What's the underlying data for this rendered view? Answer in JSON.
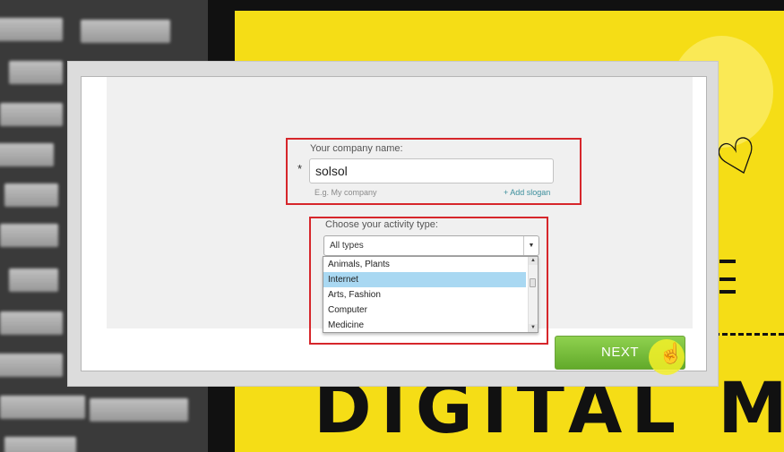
{
  "form": {
    "company_label": "Your company name:",
    "required_mark": "*",
    "company_value": "solsol",
    "company_hint": "E.g. My company",
    "add_slogan": "+ Add slogan",
    "activity_label": "Choose your activity type:",
    "activity_selected": "All types",
    "activity_options": [
      "Animals, Plants",
      "Internet",
      "Arts, Fashion",
      "Computer",
      "Medicine"
    ],
    "highlighted_option": "Internet"
  },
  "buttons": {
    "next_label": "NEXT"
  },
  "background": {
    "poster_text": "DIGITAL MAR"
  },
  "colors": {
    "highlight_border": "#d6262b",
    "next_button": "#7cc242",
    "selected_option": "#a9d8f2",
    "poster": "#f5dd16"
  }
}
